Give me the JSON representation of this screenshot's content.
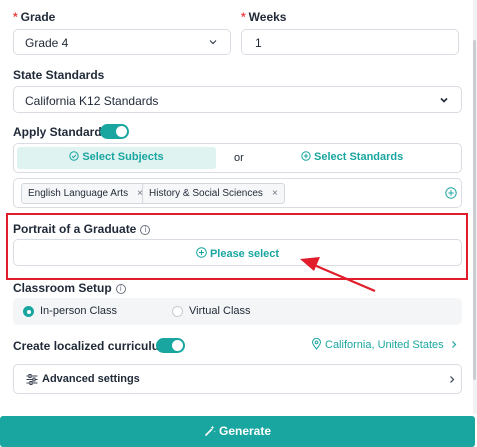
{
  "grade": {
    "label": "Grade",
    "required_mark": "*",
    "value": "Grade 4"
  },
  "weeks": {
    "label": "Weeks",
    "required_mark": "*",
    "value": "1"
  },
  "state_standards": {
    "label": "State Standards",
    "value": "California K12 Standards"
  },
  "apply_standards": {
    "label": "Apply Standards",
    "enabled": true,
    "select_subjects_label": "Select Subjects",
    "or_label": "or",
    "select_standards_label": "Select Standards",
    "tags": [
      "English Language Arts",
      "History & Social Sciences"
    ],
    "tag_remove": "×"
  },
  "portrait": {
    "label": "Portrait of a Graduate",
    "info": "i",
    "select_label": "Please select"
  },
  "classroom_setup": {
    "label": "Classroom Setup",
    "info": "i",
    "options": [
      {
        "label": "In-person Class",
        "selected": true
      },
      {
        "label": "Virtual Class",
        "selected": false
      }
    ]
  },
  "localized": {
    "label": "Create localized curriculum",
    "enabled": true,
    "location": "California, United States"
  },
  "advanced": {
    "label": "Advanced settings"
  },
  "generate": {
    "label": "Generate"
  },
  "colors": {
    "accent": "#1aa6a0",
    "highlight": "#e11d2c",
    "required": "#ef4444",
    "button_bg": "#1aa6a0"
  }
}
